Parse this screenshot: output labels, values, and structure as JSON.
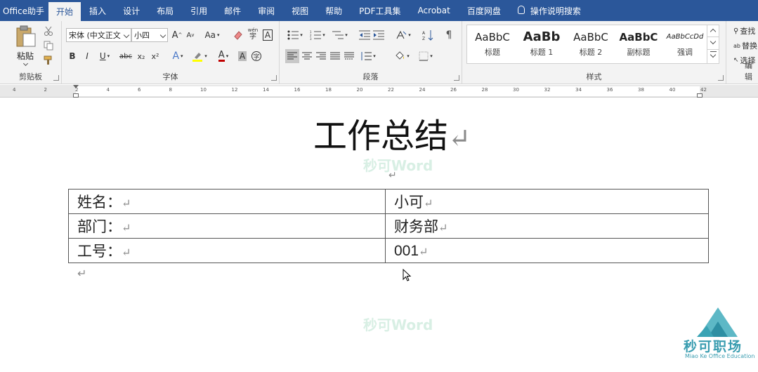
{
  "tabs": [
    {
      "label": "Office助手"
    },
    {
      "label": "开始",
      "active": true
    },
    {
      "label": "插入"
    },
    {
      "label": "设计"
    },
    {
      "label": "布局"
    },
    {
      "label": "引用"
    },
    {
      "label": "邮件"
    },
    {
      "label": "审阅"
    },
    {
      "label": "视图"
    },
    {
      "label": "帮助"
    },
    {
      "label": "PDF工具集"
    },
    {
      "label": "Acrobat"
    },
    {
      "label": "百度网盘"
    },
    {
      "label": "操作说明搜索"
    }
  ],
  "ribbon": {
    "clipboard": {
      "paste_label": "粘贴",
      "group_label": "剪贴板"
    },
    "font": {
      "font_name": "宋体 (中文正文",
      "font_size": "小四",
      "group_label": "字体",
      "case_label": "Aa",
      "grow": "A",
      "shrink": "A",
      "bold": "B",
      "italic": "I",
      "underline": "U",
      "strike": "abc",
      "sub": "x₂",
      "sup": "x²",
      "wen": "wén",
      "zi": "字"
    },
    "paragraph": {
      "group_label": "段落"
    },
    "styles": {
      "group_label": "样式",
      "items": [
        {
          "preview": "AaBbC",
          "name": "标题"
        },
        {
          "preview": "AaBb",
          "name": "标题 1"
        },
        {
          "preview": "AaBbC",
          "name": "标题 2"
        },
        {
          "preview": "AaBbC",
          "name": "副标题"
        },
        {
          "preview": "AaBbCcDd",
          "name": "强调"
        }
      ]
    },
    "editing": {
      "find": "查找",
      "replace": "替换",
      "select": "选择",
      "group_label": "编辑"
    }
  },
  "ruler": {
    "ticks": [
      "4",
      "2",
      "2",
      "4",
      "6",
      "8",
      "10",
      "12",
      "14",
      "16",
      "18",
      "20",
      "22",
      "24",
      "26",
      "28",
      "30",
      "32",
      "34",
      "36",
      "38",
      "40",
      "42"
    ]
  },
  "document": {
    "title": "工作总结",
    "pilcrow": "↵",
    "watermark": "秒可Word",
    "table": [
      [
        "姓名：",
        "小可"
      ],
      [
        "部门：",
        "财务部"
      ],
      [
        "工号：",
        "001"
      ]
    ]
  },
  "logo": {
    "name": "秒可职场",
    "subtitle": "Miao Ke Office Education"
  },
  "colors": {
    "accent": "#2b579a",
    "ribbon_bg": "#f3f3f3",
    "logo": "#3a9db0"
  }
}
